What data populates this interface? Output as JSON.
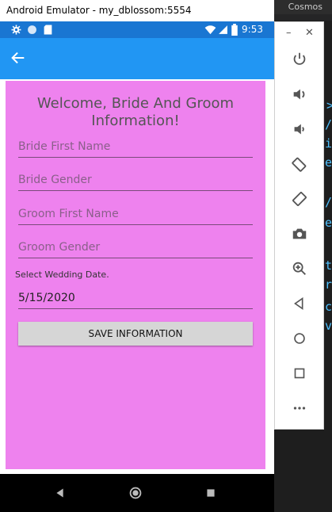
{
  "window": {
    "title": "Android Emulator - my_dblossom:5554"
  },
  "ide": {
    "tab_label": "Cosmos"
  },
  "status_bar": {
    "time": "9:53"
  },
  "app_bar": {
    "back_icon": "arrow-left-icon"
  },
  "form": {
    "heading": "Welcome, Bride And Groom Information!",
    "bride_first_name_placeholder": "Bride First Name",
    "bride_gender_placeholder": "Bride Gender",
    "groom_first_name_placeholder": "Groom First Name",
    "groom_gender_placeholder": "Groom Gender",
    "date_label": "Select Wedding Date.",
    "wedding_date": "5/15/2020",
    "save_button": "SAVE INFORMATION"
  },
  "colors": {
    "status_bar": "#1976d2",
    "app_bar": "#2196f3",
    "card": "#ee82ee",
    "button": "#d6d6d6"
  },
  "toolbar": {
    "minimize": "–",
    "close": "✕",
    "buttons": [
      "power-icon",
      "volume-up-icon",
      "volume-down-icon",
      "rotate-left-icon",
      "rotate-right-icon",
      "camera-icon",
      "zoom-icon",
      "back-icon",
      "home-icon",
      "overview-icon",
      "more-icon"
    ]
  }
}
